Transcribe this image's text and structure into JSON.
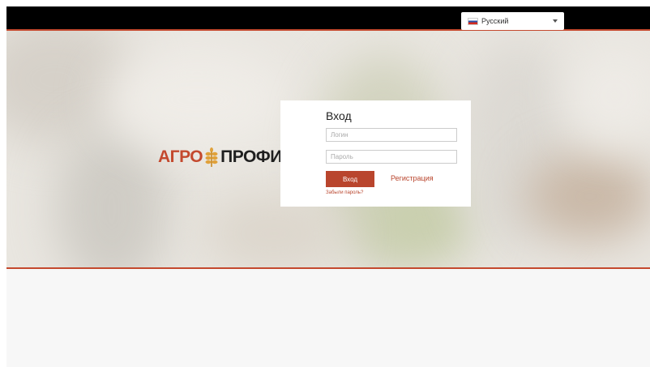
{
  "language_selector": {
    "selected": "Русский",
    "flag_icon": "russia-flag-icon"
  },
  "brand": {
    "part1": "АГРО",
    "part2": "ПРОФИЛЬ",
    "accent_color": "#c4492e"
  },
  "login": {
    "title": "Вход",
    "login_placeholder": "Логин",
    "password_placeholder": "Пароль",
    "submit_label": "Вход",
    "register_label": "Регистрация",
    "forgot_label": "Забыли пароль?"
  }
}
